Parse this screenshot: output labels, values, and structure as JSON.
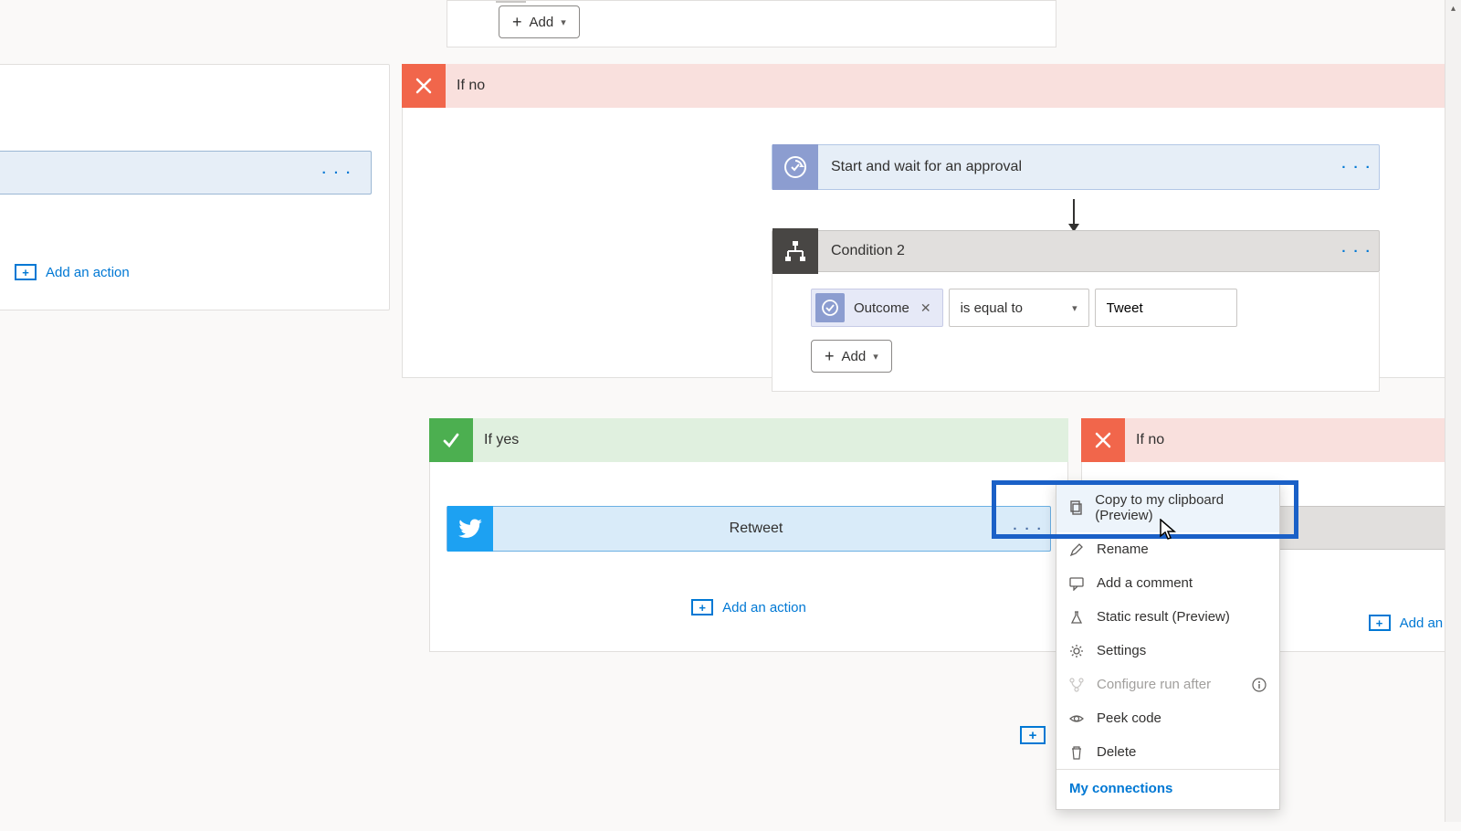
{
  "top": {
    "add_label": "Add"
  },
  "left": {
    "add_action": "Add an action"
  },
  "branch_no": {
    "label": "If no"
  },
  "branch_yes": {
    "label": "If yes"
  },
  "approval": {
    "title": "Start and wait for an approval"
  },
  "condition": {
    "title": "Condition 2",
    "chip": "Outcome",
    "operator": "is equal to",
    "value": "Tweet",
    "add_label": "Add"
  },
  "retweet": {
    "title": "Retweet"
  },
  "yes_add": "Add an action",
  "no_add": "Add an actio",
  "ctx": {
    "copy": "Copy to my clipboard (Preview)",
    "rename": "Rename",
    "comment": "Add a comment",
    "static": "Static result (Preview)",
    "settings": "Settings",
    "configure": "Configure run after",
    "peek": "Peek code",
    "delete": "Delete",
    "connections": "My connections"
  }
}
